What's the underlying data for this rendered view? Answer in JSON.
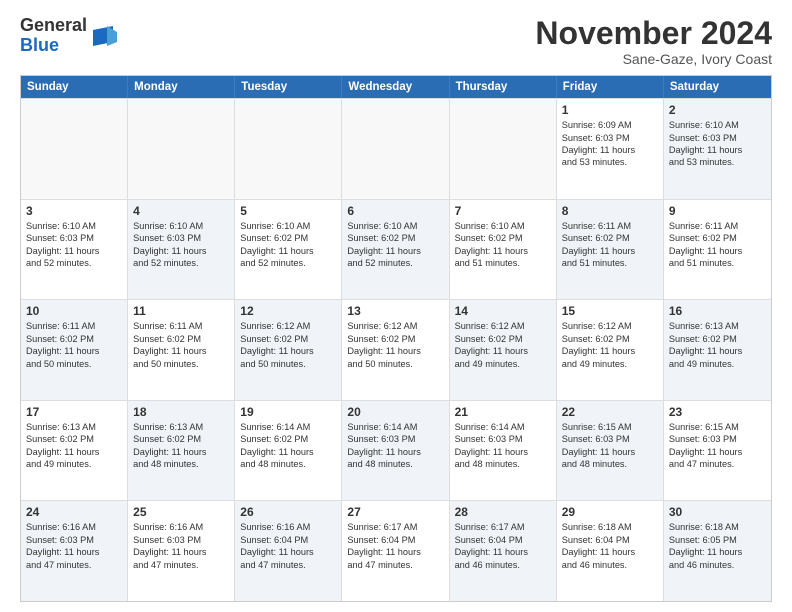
{
  "header": {
    "logo_general": "General",
    "logo_blue": "Blue",
    "month_title": "November 2024",
    "location": "Sane-Gaze, Ivory Coast"
  },
  "calendar": {
    "days_of_week": [
      "Sunday",
      "Monday",
      "Tuesday",
      "Wednesday",
      "Thursday",
      "Friday",
      "Saturday"
    ],
    "rows": [
      {
        "cells": [
          {
            "day": "",
            "empty": true
          },
          {
            "day": "",
            "empty": true
          },
          {
            "day": "",
            "empty": true
          },
          {
            "day": "",
            "empty": true
          },
          {
            "day": "",
            "empty": true
          },
          {
            "day": "1",
            "sunrise": "Sunrise: 6:09 AM",
            "sunset": "Sunset: 6:03 PM",
            "daylight": "Daylight: 11 hours",
            "minutes": "and 53 minutes.",
            "shaded": false
          },
          {
            "day": "2",
            "sunrise": "Sunrise: 6:10 AM",
            "sunset": "Sunset: 6:03 PM",
            "daylight": "Daylight: 11 hours",
            "minutes": "and 53 minutes.",
            "shaded": true
          }
        ]
      },
      {
        "cells": [
          {
            "day": "3",
            "sunrise": "Sunrise: 6:10 AM",
            "sunset": "Sunset: 6:03 PM",
            "daylight": "Daylight: 11 hours",
            "minutes": "and 52 minutes.",
            "shaded": false
          },
          {
            "day": "4",
            "sunrise": "Sunrise: 6:10 AM",
            "sunset": "Sunset: 6:03 PM",
            "daylight": "Daylight: 11 hours",
            "minutes": "and 52 minutes.",
            "shaded": true
          },
          {
            "day": "5",
            "sunrise": "Sunrise: 6:10 AM",
            "sunset": "Sunset: 6:02 PM",
            "daylight": "Daylight: 11 hours",
            "minutes": "and 52 minutes.",
            "shaded": false
          },
          {
            "day": "6",
            "sunrise": "Sunrise: 6:10 AM",
            "sunset": "Sunset: 6:02 PM",
            "daylight": "Daylight: 11 hours",
            "minutes": "and 52 minutes.",
            "shaded": true
          },
          {
            "day": "7",
            "sunrise": "Sunrise: 6:10 AM",
            "sunset": "Sunset: 6:02 PM",
            "daylight": "Daylight: 11 hours",
            "minutes": "and 51 minutes.",
            "shaded": false
          },
          {
            "day": "8",
            "sunrise": "Sunrise: 6:11 AM",
            "sunset": "Sunset: 6:02 PM",
            "daylight": "Daylight: 11 hours",
            "minutes": "and 51 minutes.",
            "shaded": true
          },
          {
            "day": "9",
            "sunrise": "Sunrise: 6:11 AM",
            "sunset": "Sunset: 6:02 PM",
            "daylight": "Daylight: 11 hours",
            "minutes": "and 51 minutes.",
            "shaded": false
          }
        ]
      },
      {
        "cells": [
          {
            "day": "10",
            "sunrise": "Sunrise: 6:11 AM",
            "sunset": "Sunset: 6:02 PM",
            "daylight": "Daylight: 11 hours",
            "minutes": "and 50 minutes.",
            "shaded": true
          },
          {
            "day": "11",
            "sunrise": "Sunrise: 6:11 AM",
            "sunset": "Sunset: 6:02 PM",
            "daylight": "Daylight: 11 hours",
            "minutes": "and 50 minutes.",
            "shaded": false
          },
          {
            "day": "12",
            "sunrise": "Sunrise: 6:12 AM",
            "sunset": "Sunset: 6:02 PM",
            "daylight": "Daylight: 11 hours",
            "minutes": "and 50 minutes.",
            "shaded": true
          },
          {
            "day": "13",
            "sunrise": "Sunrise: 6:12 AM",
            "sunset": "Sunset: 6:02 PM",
            "daylight": "Daylight: 11 hours",
            "minutes": "and 50 minutes.",
            "shaded": false
          },
          {
            "day": "14",
            "sunrise": "Sunrise: 6:12 AM",
            "sunset": "Sunset: 6:02 PM",
            "daylight": "Daylight: 11 hours",
            "minutes": "and 49 minutes.",
            "shaded": true
          },
          {
            "day": "15",
            "sunrise": "Sunrise: 6:12 AM",
            "sunset": "Sunset: 6:02 PM",
            "daylight": "Daylight: 11 hours",
            "minutes": "and 49 minutes.",
            "shaded": false
          },
          {
            "day": "16",
            "sunrise": "Sunrise: 6:13 AM",
            "sunset": "Sunset: 6:02 PM",
            "daylight": "Daylight: 11 hours",
            "minutes": "and 49 minutes.",
            "shaded": true
          }
        ]
      },
      {
        "cells": [
          {
            "day": "17",
            "sunrise": "Sunrise: 6:13 AM",
            "sunset": "Sunset: 6:02 PM",
            "daylight": "Daylight: 11 hours",
            "minutes": "and 49 minutes.",
            "shaded": false
          },
          {
            "day": "18",
            "sunrise": "Sunrise: 6:13 AM",
            "sunset": "Sunset: 6:02 PM",
            "daylight": "Daylight: 11 hours",
            "minutes": "and 48 minutes.",
            "shaded": true
          },
          {
            "day": "19",
            "sunrise": "Sunrise: 6:14 AM",
            "sunset": "Sunset: 6:02 PM",
            "daylight": "Daylight: 11 hours",
            "minutes": "and 48 minutes.",
            "shaded": false
          },
          {
            "day": "20",
            "sunrise": "Sunrise: 6:14 AM",
            "sunset": "Sunset: 6:03 PM",
            "daylight": "Daylight: 11 hours",
            "minutes": "and 48 minutes.",
            "shaded": true
          },
          {
            "day": "21",
            "sunrise": "Sunrise: 6:14 AM",
            "sunset": "Sunset: 6:03 PM",
            "daylight": "Daylight: 11 hours",
            "minutes": "and 48 minutes.",
            "shaded": false
          },
          {
            "day": "22",
            "sunrise": "Sunrise: 6:15 AM",
            "sunset": "Sunset: 6:03 PM",
            "daylight": "Daylight: 11 hours",
            "minutes": "and 48 minutes.",
            "shaded": true
          },
          {
            "day": "23",
            "sunrise": "Sunrise: 6:15 AM",
            "sunset": "Sunset: 6:03 PM",
            "daylight": "Daylight: 11 hours",
            "minutes": "and 47 minutes.",
            "shaded": false
          }
        ]
      },
      {
        "cells": [
          {
            "day": "24",
            "sunrise": "Sunrise: 6:16 AM",
            "sunset": "Sunset: 6:03 PM",
            "daylight": "Daylight: 11 hours",
            "minutes": "and 47 minutes.",
            "shaded": true
          },
          {
            "day": "25",
            "sunrise": "Sunrise: 6:16 AM",
            "sunset": "Sunset: 6:03 PM",
            "daylight": "Daylight: 11 hours",
            "minutes": "and 47 minutes.",
            "shaded": false
          },
          {
            "day": "26",
            "sunrise": "Sunrise: 6:16 AM",
            "sunset": "Sunset: 6:04 PM",
            "daylight": "Daylight: 11 hours",
            "minutes": "and 47 minutes.",
            "shaded": true
          },
          {
            "day": "27",
            "sunrise": "Sunrise: 6:17 AM",
            "sunset": "Sunset: 6:04 PM",
            "daylight": "Daylight: 11 hours",
            "minutes": "and 47 minutes.",
            "shaded": false
          },
          {
            "day": "28",
            "sunrise": "Sunrise: 6:17 AM",
            "sunset": "Sunset: 6:04 PM",
            "daylight": "Daylight: 11 hours",
            "minutes": "and 46 minutes.",
            "shaded": true
          },
          {
            "day": "29",
            "sunrise": "Sunrise: 6:18 AM",
            "sunset": "Sunset: 6:04 PM",
            "daylight": "Daylight: 11 hours",
            "minutes": "and 46 minutes.",
            "shaded": false
          },
          {
            "day": "30",
            "sunrise": "Sunrise: 6:18 AM",
            "sunset": "Sunset: 6:05 PM",
            "daylight": "Daylight: 11 hours",
            "minutes": "and 46 minutes.",
            "shaded": true
          }
        ]
      }
    ]
  }
}
